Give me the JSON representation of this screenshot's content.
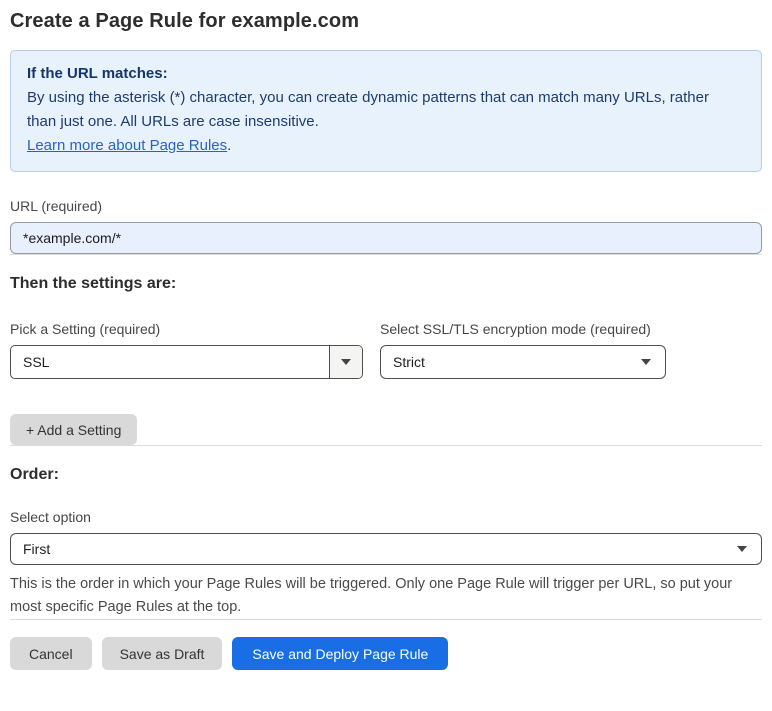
{
  "page": {
    "title": "Create a Page Rule for example.com"
  },
  "info_box": {
    "heading": "If the URL matches:",
    "body": "By using the asterisk (*) character, you can create dynamic patterns that can match many URLs, rather than just one. All URLs are case insensitive.",
    "link_label": "Learn more about Page Rules",
    "link_suffix": "."
  },
  "url_field": {
    "label": "URL (required)",
    "value": "*example.com/*"
  },
  "settings_section": {
    "heading": "Then the settings are:",
    "setting_select": {
      "label": "Pick a Setting (required)",
      "value": "SSL"
    },
    "ssl_mode_select": {
      "label": "Select SSL/TLS encryption mode (required)",
      "value": "Strict"
    },
    "add_setting_label": "+ Add a Setting"
  },
  "order_section": {
    "heading": "Order:",
    "select_label": "Select option",
    "select_value": "First",
    "help_text": "This is the order in which your Page Rules will be triggered. Only one Page Rule will trigger per URL, so put your most specific Page Rules at the top."
  },
  "footer": {
    "cancel_label": "Cancel",
    "save_draft_label": "Save as Draft",
    "save_deploy_label": "Save and Deploy Page Rule"
  },
  "colors": {
    "accent_blue": "#1a6ee5",
    "info_bg": "#e8f2fc",
    "info_border": "#b6cfe8",
    "info_text": "#1d3c6e",
    "link_blue": "#2962c4",
    "autofill_input_bg": "#e8f0fe",
    "button_gray": "#d9d9d9",
    "divider_gray": "#dcdcdc"
  }
}
